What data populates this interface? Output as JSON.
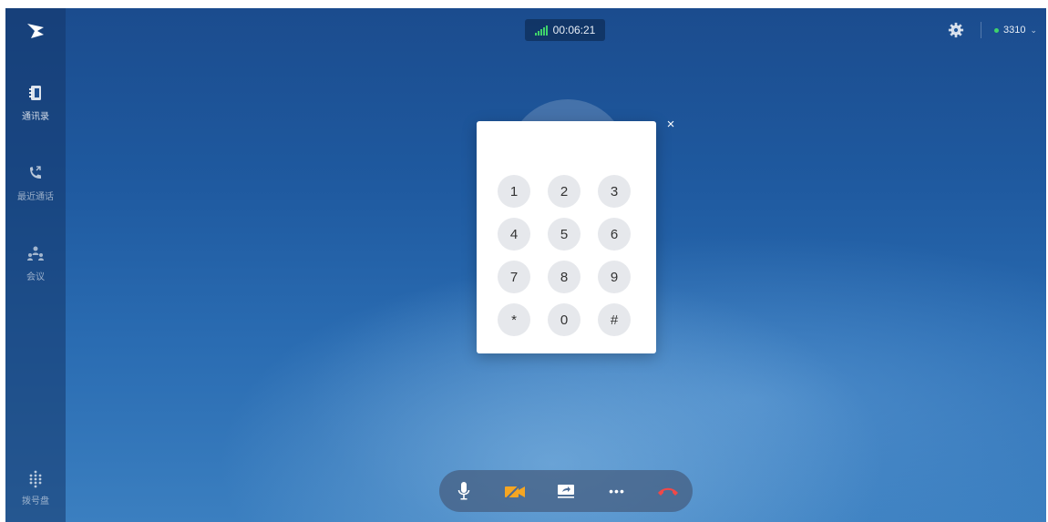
{
  "sidebar": {
    "items": [
      {
        "label": "通讯录",
        "icon": "contacts-icon"
      },
      {
        "label": "最近通话",
        "icon": "recent-calls-icon"
      },
      {
        "label": "会议",
        "icon": "meeting-icon"
      }
    ],
    "bottom_item": {
      "label": "拨号盘",
      "icon": "dialpad-icon"
    }
  },
  "call": {
    "duration": "00:06:21",
    "signal_icon": "signal-strength-icon",
    "signal_color": "#3fd36b"
  },
  "account": {
    "extension": "3310",
    "status_color": "#3fd36b"
  },
  "dialpad": {
    "keys": [
      "1",
      "2",
      "3",
      "4",
      "5",
      "6",
      "7",
      "8",
      "9",
      "*",
      "0",
      "#"
    ],
    "close_label": "×"
  },
  "controls": {
    "items": [
      "microphone-icon",
      "camera-off-icon",
      "screen-share-icon",
      "more-icon",
      "hangup-icon"
    ],
    "more_label": "•••",
    "hangup_color": "#f04848",
    "camera_off_color": "#f5a623"
  }
}
